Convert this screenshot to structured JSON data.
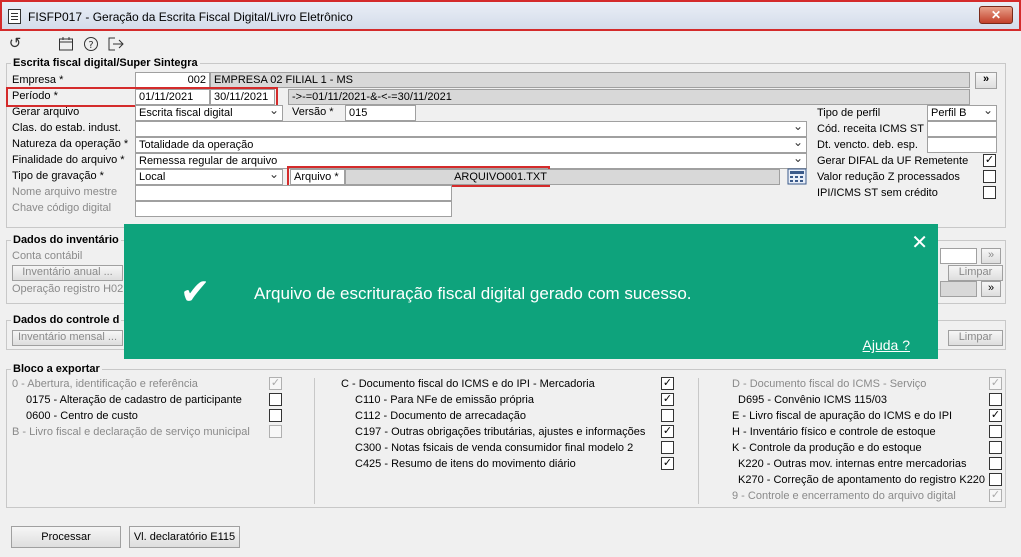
{
  "window": {
    "title": "FISFP017 - Geração da Escrita Fiscal Digital/Livro Eletrônico",
    "close_label": "✕"
  },
  "toolbar": {
    "refresh_icon": "refresh-icon",
    "calendar_icon": "calendar-icon",
    "help_icon": "help-icon",
    "exit_icon": "exit-icon"
  },
  "escrita": {
    "title": "Escrita fiscal digital/Super Sintegra",
    "empresa_label": "Empresa *",
    "empresa_code": "002",
    "empresa_name": "EMPRESA 02 FILIAL 1 - MS",
    "empresa_btn": "»",
    "periodo_label": "Período *",
    "periodo_inicio": "01/11/2021",
    "periodo_fim": "30/11/2021",
    "periodo_expr": "->-=01/11/2021-&-<-=30/11/2021",
    "gerar_label": "Gerar arquivo",
    "gerar_value": "Escrita fiscal digital",
    "versao_label": "Versão *",
    "versao_value": "015",
    "clas_label": "Clas. do estab. indust.",
    "clas_value": "",
    "natureza_label": "Natureza da operação *",
    "natureza_value": "Totalidade da operação",
    "finalidade_label": "Finalidade do arquivo *",
    "finalidade_value": "Remessa regular de arquivo",
    "tipo_grav_label": "Tipo de gravação *",
    "tipo_grav_value": "Local",
    "arquivo_label": "Arquivo *",
    "arquivo_value": "ARQUIVO001.TXT",
    "nome_mestre_label": "Nome arquivo mestre",
    "chave_label": "Chave código digital",
    "tipo_perfil_label": "Tipo de perfil",
    "tipo_perfil_value": "Perfil B",
    "cod_receita_label": "Cód. receita ICMS ST",
    "dt_vencto_label": "Dt. vencto. deb. esp.",
    "gerar_difal_label": "Gerar DIFAL da UF Remetente",
    "valor_reducao_label": "Valor redução Z processados",
    "ipi_label": "IPI/ICMS ST sem crédito"
  },
  "inventario": {
    "title": "Dados do inventário",
    "conta_label": "Conta contábil",
    "inv_anual_btn": "Inventário anual ...",
    "operacao_label": "Operação registro H02",
    "limpar_btn": "Limpar"
  },
  "controle": {
    "title": "Dados do controle d",
    "inv_mensal_btn": "Inventário mensal ...",
    "limpar_btn": "Limpar"
  },
  "bloco": {
    "title": "Bloco a exportar",
    "col1": [
      {
        "label": "0 - Abertura, identificação e referência",
        "checked": true,
        "disabled": true
      },
      {
        "label": "0175 - Alteração de cadastro de participante",
        "checked": false,
        "disabled": false
      },
      {
        "label": "0600 - Centro de custo",
        "checked": false,
        "disabled": false
      },
      {
        "label": "B - Livro fiscal e declaração de serviço municipal",
        "checked": false,
        "disabled": true
      }
    ],
    "col2": [
      {
        "label": "C - Documento fiscal do ICMS e do IPI - Mercadoria",
        "checked": true,
        "disabled": false
      },
      {
        "label": "C110 - Para NFe de emissão própria",
        "checked": true,
        "disabled": false
      },
      {
        "label": "C112 - Documento de arrecadação",
        "checked": false,
        "disabled": false
      },
      {
        "label": "C197 - Outras obrigações tributárias, ajustes e informações",
        "checked": true,
        "disabled": false
      },
      {
        "label": "C300 - Notas fsicais de venda consumidor final modelo 2",
        "checked": false,
        "disabled": false
      },
      {
        "label": "C425 - Resumo de itens do movimento diário",
        "checked": true,
        "disabled": false
      }
    ],
    "col3": [
      {
        "label": "D - Documento fiscal do ICMS - Serviço",
        "checked": true,
        "disabled": true
      },
      {
        "label": "D695 - Convênio ICMS 115/03",
        "checked": false,
        "disabled": false
      },
      {
        "label": "E - Livro fiscal de apuração do ICMS e do IPI",
        "checked": true,
        "disabled": false
      },
      {
        "label": "H - Inventário físico e controle de estoque",
        "checked": false,
        "disabled": false
      },
      {
        "label": "K - Controle da produção e do estoque",
        "checked": false,
        "disabled": false
      },
      {
        "label": "K220 - Outras mov. internas entre mercadorias",
        "checked": false,
        "disabled": false
      },
      {
        "label": "K270 - Correção de apontamento do registro K220",
        "checked": false,
        "disabled": false
      },
      {
        "label": "9 - Controle e encerramento do arquivo digital",
        "checked": true,
        "disabled": true
      }
    ]
  },
  "footer": {
    "processar_btn": "Processar",
    "vl_declaratorio_btn": "Vl. declaratório E115"
  },
  "toast": {
    "message": "Arquivo de escrituração fiscal digital gerado com sucesso.",
    "help_link": "Ajuda ?",
    "close": "✕",
    "check": "✔",
    "color": "#0ea37c"
  }
}
